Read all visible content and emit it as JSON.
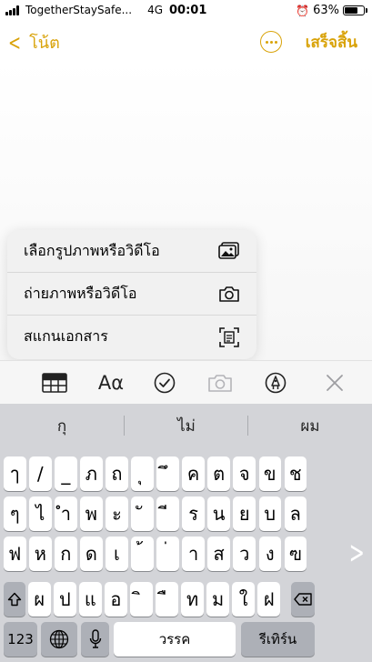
{
  "status_bar": {
    "carrier": "TogetherStaySafe...",
    "network": "4G",
    "time": "00:01",
    "battery": "63%",
    "battery_level": 0.63
  },
  "nav": {
    "back_label": "โน้ต",
    "done_label": "เสร็จสิ้น",
    "accent_color": "#d9a30a"
  },
  "attach_menu": {
    "items": [
      {
        "label": "เลือกรูปภาพหรือวิดีโอ",
        "icon": "photo-library-icon"
      },
      {
        "label": "ถ่ายภาพหรือวิดีโอ",
        "icon": "camera-icon"
      },
      {
        "label": "สแกนเอกสาร",
        "icon": "scan-document-icon"
      }
    ]
  },
  "toolbar": {
    "text_style_label": "Aα",
    "icons": [
      "table-icon",
      "text-style-icon",
      "checklist-icon",
      "camera-icon",
      "markup-icon",
      "close-icon"
    ]
  },
  "keyboard": {
    "predictions": [
      "กุ",
      "ไม่",
      "ผม"
    ],
    "rows": [
      [
        "ๅ",
        "/",
        "_",
        "ภ",
        "ถ",
        "ุ",
        "ึ",
        "ค",
        "ต",
        "จ",
        "ข",
        "ช"
      ],
      [
        "ๆ",
        "ไ",
        "ำ",
        "พ",
        "ะ",
        "ั",
        "ี",
        "ร",
        "น",
        "ย",
        "บ",
        "ล"
      ],
      [
        "ฟ",
        "ห",
        "ก",
        "ด",
        "เ",
        "้",
        "่",
        "า",
        "ส",
        "ว",
        "ง",
        "ฃ"
      ],
      [
        "ผ",
        "ป",
        "แ",
        "อ",
        "ิ",
        "ื",
        "ท",
        "ม",
        "ใ",
        "ฝ"
      ]
    ],
    "numbers_key": "123",
    "space_key": "วรรค",
    "return_key": "รีเทิร์น"
  }
}
